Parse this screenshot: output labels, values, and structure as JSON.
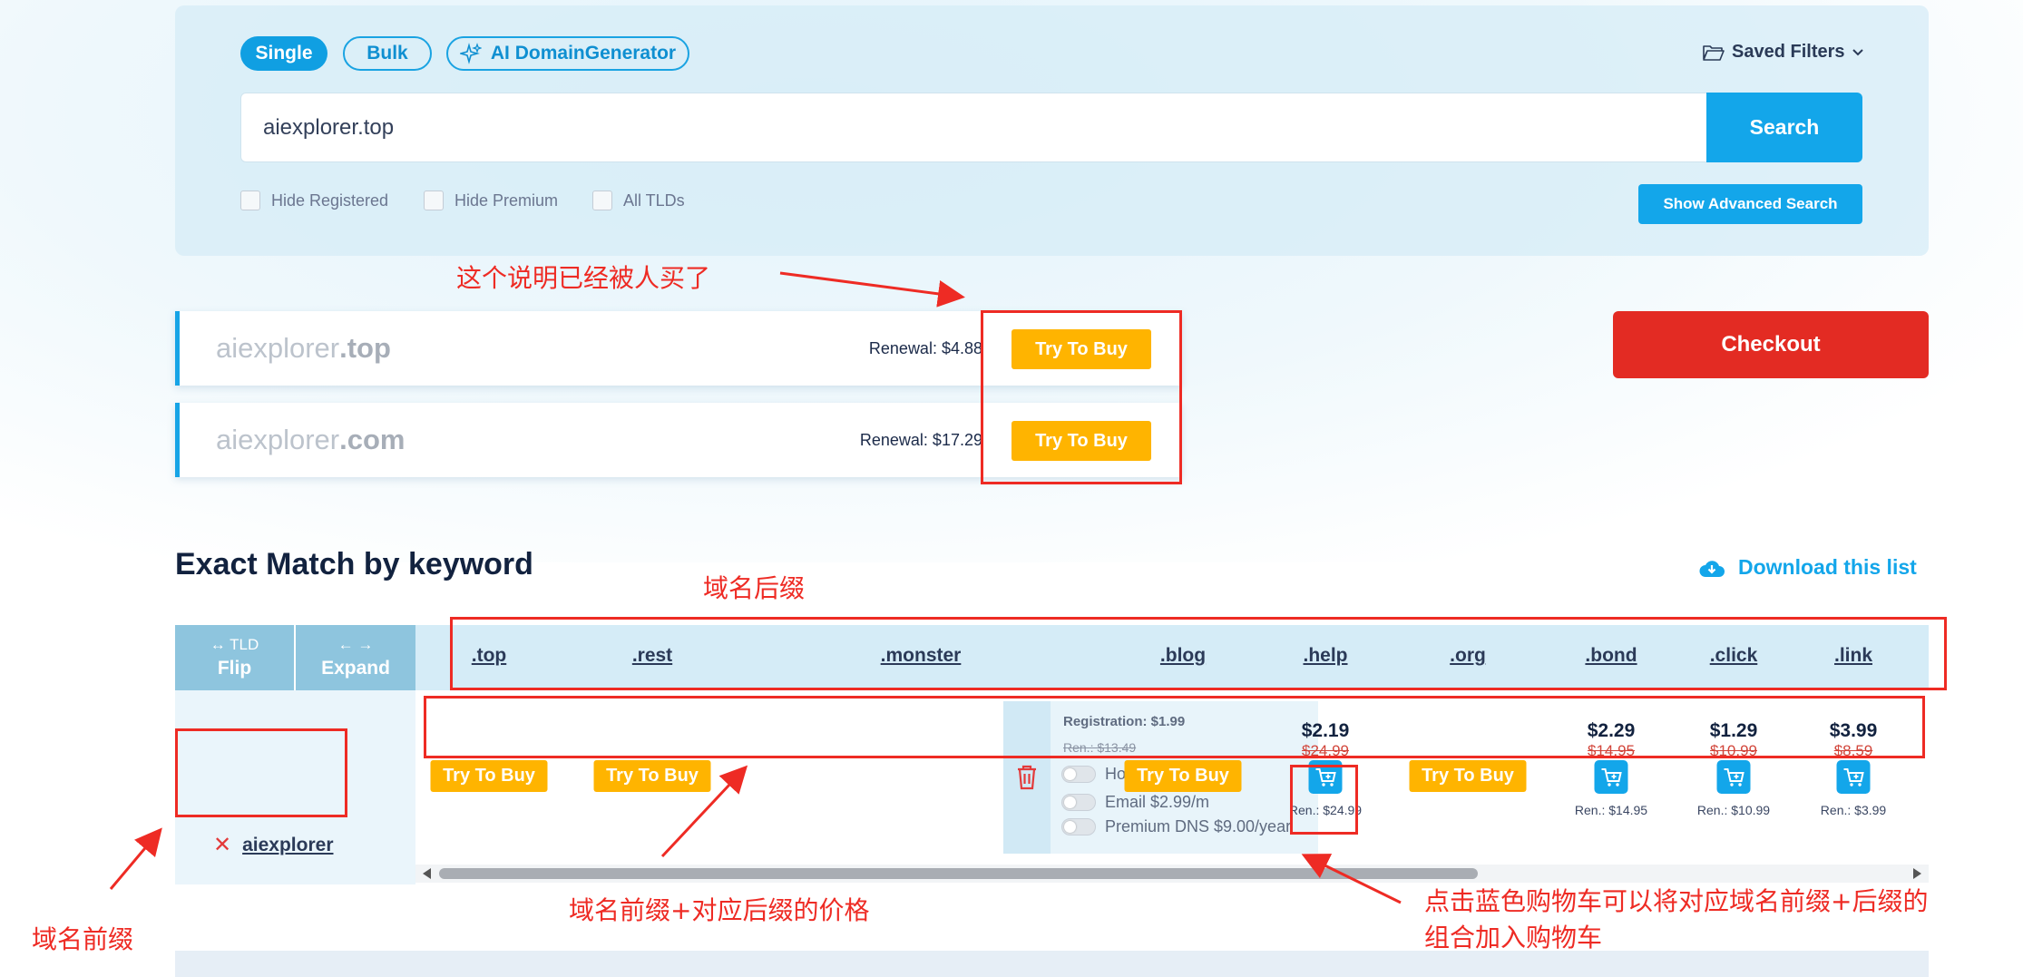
{
  "search": {
    "modes": [
      "Single",
      "Bulk",
      "AI DomainGenerator"
    ],
    "saved_filters": "Saved Filters",
    "query": "aiexplorer.top",
    "button": "Search",
    "filters": [
      "Hide Registered",
      "Hide Premium",
      "All TLDs"
    ],
    "advanced": "Show Advanced Search"
  },
  "results": [
    {
      "name": "aiexplorer",
      "tld": ".top",
      "renewal": "Renewal: $4.88",
      "action": "Try To Buy"
    },
    {
      "name": "aiexplorer",
      "tld": ".com",
      "renewal": "Renewal: $17.29",
      "action": "Try To Buy"
    }
  ],
  "checkout": "Checkout",
  "section": {
    "title": "Exact Match by keyword",
    "download": "Download this list"
  },
  "table": {
    "flip_small": "TLD",
    "flip_label": "Flip",
    "expand_label": "Expand",
    "keyword": "aiexplorer",
    "tlds": [
      ".top",
      ".rest",
      ".monster",
      ".blog",
      ".help",
      ".org",
      ".bond",
      ".click",
      ".link"
    ],
    "try_label": "Try To Buy",
    "help": {
      "price": "$2.19",
      "old": "$24.99",
      "ren": "Ren.: $24.99"
    },
    "bond": {
      "price": "$2.29",
      "old": "$14.95",
      "ren": "Ren.: $14.95"
    },
    "click": {
      "price": "$1.29",
      "old": "$10.99",
      "ren": "Ren.: $10.99"
    },
    "link": {
      "price": "$3.99",
      "old": "$8.59",
      "ren": "Ren.: $3.99"
    },
    "monster": {
      "registration": "Registration: $1.99",
      "renewal": "Ren.: $13.49",
      "options": [
        "Hosting $2.99/m",
        "Email $2.99/m",
        "Premium DNS $9.00/year"
      ]
    }
  },
  "annotations": {
    "bought": "这个说明已经被人买了",
    "suffix": "域名后缀",
    "prefix": "域名前缀",
    "price_note": "域名前缀+对应后缀的价格",
    "cart_note_1": "点击蓝色购物车可以将对应域名前缀+后缀的",
    "cart_note_2": "组合加入购物车"
  },
  "colors": {
    "accent": "#13a6ea",
    "try": "#ffb400",
    "checkout": "#e32b23",
    "annotation": "#ee2b24"
  }
}
